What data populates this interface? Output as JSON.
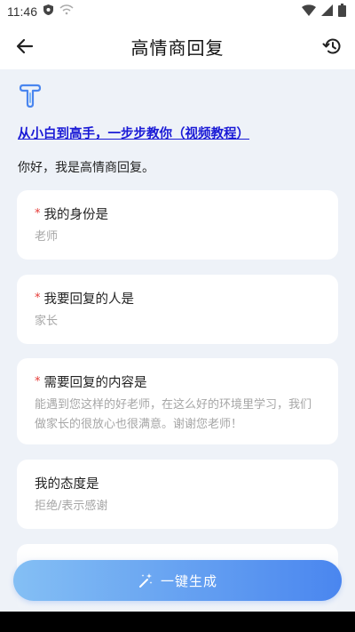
{
  "status_bar": {
    "time": "11:46",
    "icons": [
      "shield-icon",
      "wifi-off-icon",
      "wifi-icon",
      "signal-icon",
      "battery-icon"
    ]
  },
  "header": {
    "title": "高情商回复",
    "back_icon": "arrow-left-icon",
    "history_icon": "history-icon"
  },
  "intro": {
    "tutorial_link": "从小白到高手，一步步教你（视频教程）",
    "greeting": "你好，我是高情商回复。"
  },
  "form": {
    "identity": {
      "label": "我的身份是",
      "required": "*",
      "placeholder": "老师"
    },
    "recipient": {
      "label": "我要回复的人是",
      "required": "*",
      "placeholder": "家长"
    },
    "content": {
      "label": "需要回复的内容是",
      "required": "*",
      "placeholder": "能遇到您这样的好老师，在这么好的环境里学习，我们做家长的很放心也很满意。谢谢您老师！"
    },
    "attitude": {
      "label": "我的态度是",
      "placeholder": "拒绝/表示感谢"
    }
  },
  "actions": {
    "generate_label": "一键生成"
  },
  "colors": {
    "accent": "#4a86ef",
    "link": "#1a1ad6",
    "required": "#e53935",
    "background": "#eef2f8"
  }
}
